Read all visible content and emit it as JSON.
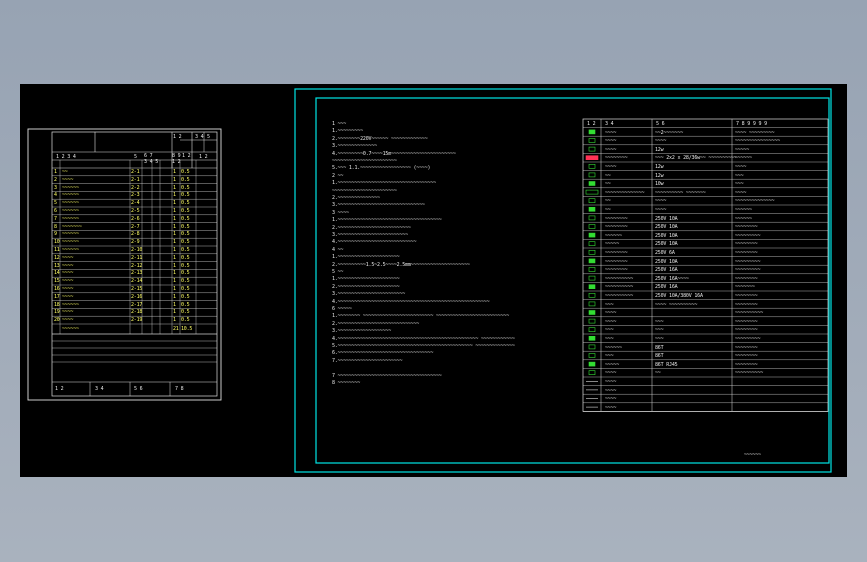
{
  "drawing_list": {
    "header": [
      "1 2",
      "3 4",
      "5",
      "1 2 3 4",
      "5",
      "6 7",
      "8 9",
      "1 2",
      "1 2",
      "3 4 5",
      "1 2"
    ],
    "rows": [
      {
        "no": "1",
        "name": "~~",
        "code": "2-1",
        "q": "1",
        "s": "0.5"
      },
      {
        "no": "2",
        "name": "~~~~",
        "code": "2-1",
        "q": "1",
        "s": "0.5"
      },
      {
        "no": "3",
        "name": "~~~~~~",
        "code": "2-2",
        "q": "1",
        "s": "0.5"
      },
      {
        "no": "4",
        "name": "~~~~~~",
        "code": "2-3",
        "q": "1",
        "s": "0.5"
      },
      {
        "no": "5",
        "name": "~~~~~~",
        "code": "2-4",
        "q": "1",
        "s": "0.5"
      },
      {
        "no": "6",
        "name": "~~~~~~",
        "code": "2-5",
        "q": "1",
        "s": "0.5"
      },
      {
        "no": "7",
        "name": "~~~~~~",
        "code": "2-6",
        "q": "1",
        "s": "0.5"
      },
      {
        "no": "8",
        "name": "~~~~~~~",
        "code": "2-7",
        "q": "1",
        "s": "0.5"
      },
      {
        "no": "9",
        "name": "~~~~~~",
        "code": "2-8",
        "q": "1",
        "s": "0.5"
      },
      {
        "no": "10",
        "name": "~~~~~~",
        "code": "2-9",
        "q": "1",
        "s": "0.5"
      },
      {
        "no": "11",
        "name": "~~~~~~",
        "code": "2-10",
        "q": "1",
        "s": "0.5"
      },
      {
        "no": "12",
        "name": "~~~~",
        "code": "2-11",
        "q": "1",
        "s": "0.5"
      },
      {
        "no": "13",
        "name": "~~~~",
        "code": "2-12",
        "q": "1",
        "s": "0.5"
      },
      {
        "no": "14",
        "name": "~~~~",
        "code": "2-13",
        "q": "1",
        "s": "0.5"
      },
      {
        "no": "15",
        "name": "~~~~",
        "code": "2-14",
        "q": "1",
        "s": "0.5"
      },
      {
        "no": "16",
        "name": "~~~~",
        "code": "2-15",
        "q": "1",
        "s": "0.5"
      },
      {
        "no": "17",
        "name": "~~~~",
        "code": "2-16",
        "q": "1",
        "s": "0.5"
      },
      {
        "no": "18",
        "name": "~~~~~~",
        "code": "2-17",
        "q": "1",
        "s": "0.5"
      },
      {
        "no": "19",
        "name": "~~~~",
        "code": "2-18",
        "q": "1",
        "s": "0.5"
      },
      {
        "no": "20",
        "name": "~~~~",
        "code": "2-19",
        "q": "1",
        "s": "0.5"
      }
    ],
    "total": {
      "name": "~~~~~~",
      "q": "21",
      "s": "10.5"
    },
    "footer": [
      "1 2",
      "3 4",
      "5 6",
      "7 8"
    ]
  },
  "notes": [
    "1 ~~~",
    "  1.~~~~~~~~~",
    "  2.~~~~~~~~220V~~~~~~  ~~~~~~~~~~~~~",
    "  3.~~~~~~~~~~~~~~",
    "  4.~~~~~~~~~0.7~~~~15m~~~~~~~~~~~~~~~~~~~~~~~",
    "    ~~~~~~~~~~~~~~~~~~~~~~~",
    "  5.~~~   1.1.~~~~~~~~~~~~~~~~~~   (~~~~)",
    "2 ~~",
    "  1.~~~~~~~~~~~~~~~~~~~~~~~~~~~~~~~~~~~",
    "    ~~~~~~~~~~~~~~~~~~~~~~~",
    "  2.~~~~~~~~~~~~~~~",
    "  3.~~~~~~~~~~~~~~~~~~~~~~~~~~~~~~~",
    "3 ~~~~",
    "  1.~~~~~~~~~~~~~~~~~~~~~~~~~~~~~~~~~~~~~",
    "  2.~~~~~~~~~~~~~~~~~~~~~~~~~~",
    "  3.~~~~~~~~~~~~~~~~~~~~~~~~~",
    "  4.~~~~~~~~~~~~~~~~~~~~~~~~~~~~",
    "4 ~~",
    "  1.~~~~~~~~~~~~~~~~~~~~~~",
    "  2.~~~~~~~~~~1.5~2.5~~~~2.5mm~~~~~~~~~~~~~~~~~~~~~",
    "5 ~~",
    "  1.~~~~~~~~~~~~~~~~~~~~~~",
    "  2.~~~~~~~~~~~~~~~~~~~~~~",
    "  3.~~~~~~~~~~~~~~~~~~~~~~~~",
    "  4.~~~~~~~~~~~~~~~~~~~~~~~~~~~~~~~~~~~~~~~~~~~~~~~~~~~~~~",
    "6 ~~~~~",
    "  1.~~~~~~~~ ~~~~~~~~~~~~~~~~~~~~~~~~~       ~~~~~~~~~~~~~~~~~~~~~~~~~~",
    "  2.~~~~~~~~~~~~~~~~~~~~~~~~~~~~~",
    "  3.~~~~~~~~~~~~~~~~~~~",
    "  4.~~~~~~~~~~~~~~~~~~~~~~~~~~~~~~~~~~~~~~~~~~~~~~~~~~       ~~~~~~~~~~~~",
    "  5.~~~~~~~~~~~~~~~~~~~~~~~~~~~~~~~~~~~~~~~~~~~~~~~~         ~~~~~~~~~~~~~~",
    "  6.~~~~~~~~~~~~~~~~~~~~~~~~~~~~~~~~~~",
    "  7.~~~~~~~~~~~~~~~~~~~~~~~",
    "",
    "7 ~~~~~~~~~~~~~~~~~~~~~~~~~~~~~~~~~~~~~",
    "8 ~~~~~~~~"
  ],
  "legend": {
    "header": [
      "1 2",
      "3 4",
      "5 6",
      "7 8 9 9 9 9"
    ],
    "rows": [
      {
        "b": "~~~~",
        "c": "~~2~~~~~~~",
        "d": "~~~~ ~~~~~~~~~"
      },
      {
        "b": "~~~~",
        "c": "~~~~",
        "d": "~~~~~~~~~~~~~~~~"
      },
      {
        "b": "~~~~",
        "c": "12w",
        "d": "~~~~~"
      },
      {
        "b": "~~~~~~~~",
        "c": "~~~  2x2 x 28/36w~~  ~~~~~~~~~~",
        "d": "~~~~~~"
      },
      {
        "b": "~~~~",
        "c": "12w",
        "d": "~~~~"
      },
      {
        "b": "~~",
        "c": "12w",
        "d": "~~~"
      },
      {
        "b": "~~",
        "c": "10w",
        "d": "~~~"
      },
      {
        "b": "~~~~~~~~~~~~~~",
        "c": "~~~~~~~~~~ ~~~~~~~",
        "d": "~~~~"
      },
      {
        "b": "~~",
        "c": "~~~~",
        "d": "~~~~~~~~~~~~~~"
      },
      {
        "b": "~~",
        "c": "~~~~",
        "d": "~~~~~~"
      },
      {
        "b": "~~~~~~~~",
        "c": "250V 10A",
        "d": "~~~~~~"
      },
      {
        "b": "~~~~~~~~",
        "c": "250V 10A",
        "d": "~~~~~~~~"
      },
      {
        "b": "~~~~~~",
        "c": "250V 10A",
        "d": "~~~~~~~~~"
      },
      {
        "b": "~~~~~",
        "c": "250V 10A",
        "d": "~~~~~~~~"
      },
      {
        "b": "~~~~~~~~",
        "c": "250V 6A",
        "d": "~~~~~~~~"
      },
      {
        "b": "~~~~~~~~",
        "c": "250V 10A",
        "d": "~~~~~~~~~"
      },
      {
        "b": "~~~~~~~~",
        "c": "250V 16A",
        "d": "~~~~~~~~~"
      },
      {
        "b": "~~~~~~~~~~",
        "c": "250V 16A~~~~",
        "d": "~~~~~~~~"
      },
      {
        "b": "~~~~~~~~~~",
        "c": "250V 16A",
        "d": "~~~~~~~"
      },
      {
        "b": "~~~~~~~~~~",
        "c": "250V 10A/380V 16A",
        "d": "~~~~~~~~"
      },
      {
        "b": "~~~",
        "c": "~~~~  ~~~~~~~~~~",
        "d": "~~~~~~~~"
      },
      {
        "b": "~~~~",
        "c": "",
        "d": "~~~~~~~~~~"
      },
      {
        "b": "~~~~",
        "c": "~~~",
        "d": "~~~~~~~~"
      },
      {
        "b": "~~~",
        "c": "~~~",
        "d": "~~~~~~~~"
      },
      {
        "b": "~~~",
        "c": "~~~",
        "d": "~~~~~~~~~"
      },
      {
        "b": "~~~~~~",
        "c": "86T",
        "d": "~~~~~~~~"
      },
      {
        "b": "~~~",
        "c": "86T",
        "d": "~~~~~~~~"
      },
      {
        "b": "~~~~~",
        "c": "86T RJ45",
        "d": "~~~~~~~~"
      },
      {
        "b": "~~~~",
        "c": "~~",
        "d": "~~~~~~~~~~"
      },
      {
        "b": "~~~~",
        "c": "",
        "d": ""
      },
      {
        "b": "~~~~",
        "c": "",
        "d": ""
      },
      {
        "b": "~~~~",
        "c": "",
        "d": ""
      },
      {
        "b": "~~~~",
        "c": "",
        "d": ""
      }
    ]
  },
  "title_block_text": "~~~~~~",
  "colors": {
    "canvas": "#000000",
    "frame": "#00e5e5",
    "line": "#e0e0e0",
    "symbol": "#33dd33",
    "desktop": "#9aa6b6"
  }
}
